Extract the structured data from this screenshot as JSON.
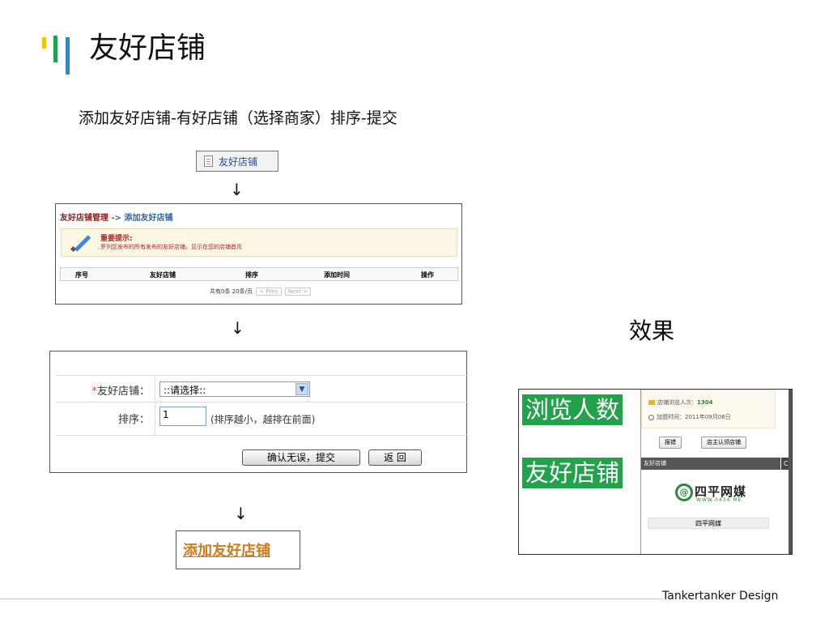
{
  "slide": {
    "title": "友好店铺",
    "subtitle": "添加友好店铺-有好店铺（选择商家）排序-提交",
    "effect_label": "效果",
    "footer": "Tankertanker Design",
    "accent_colors": {
      "yellow": "#f3c400",
      "green": "#21a04a",
      "blue": "#1e8ed8"
    }
  },
  "arrows": [
    "↓",
    "↓",
    "↓"
  ],
  "step1": {
    "icon": "document-icon",
    "label": "友好店铺"
  },
  "step2": {
    "breadcrumb_main": "友好店铺管理",
    "breadcrumb_sep": " ->",
    "breadcrumb_sub": "添加友好店铺",
    "notice_title": "重要提示:",
    "notice_text": "罗列您发布的所有发布的友好店铺，显示在您的店铺首页",
    "columns": [
      "序号",
      "友好店铺",
      "排序",
      "添加时间",
      "操作"
    ],
    "pager_text": "共有0条 20条/页",
    "pager_prev": "< Prev",
    "pager_next": "Next >"
  },
  "step3": {
    "shop_required_mark": "*",
    "shop_label": "友好店铺：",
    "shop_select_value": "::请选择::",
    "sort_label": "排序：",
    "sort_value": "1",
    "sort_hint": "(排序越小，越排在前面)",
    "submit_label": "确认无误，提交",
    "back_label": "返 回"
  },
  "step4": {
    "link_label": "添加友好店铺"
  },
  "effect": {
    "label_views": "浏览人数",
    "label_friends": "友好店铺",
    "views_label": "店铺浏览人次：",
    "views_value": "1304",
    "joined_label": "加盟时间：",
    "joined_value": "2011年09月08日",
    "report_button": "报错",
    "claim_button": "店主认领店铺",
    "section_title": "友好店铺",
    "section_tab": "C",
    "logo_symbol": "@",
    "logo_text": "四平网媒",
    "logo_url": "WWW.0434.ME",
    "shop_name": "四平网媒"
  }
}
